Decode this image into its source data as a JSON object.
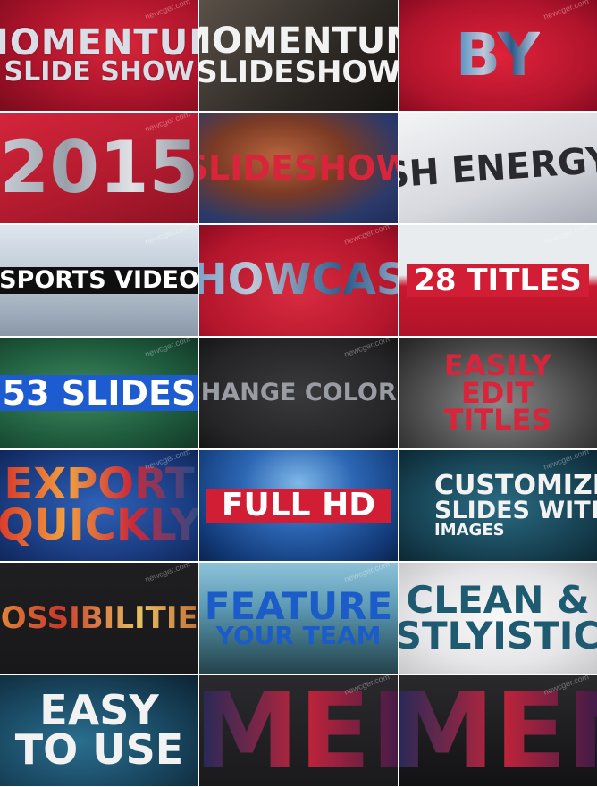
{
  "watermark": "newcger.com",
  "tiles": [
    {
      "lines": [
        "MOMENTUM",
        "SLIDE SHOW"
      ]
    },
    {
      "lines": [
        "MOMENTUM",
        "SLIDESHOW"
      ]
    },
    {
      "lines": [
        "BY"
      ]
    },
    {
      "lines": [
        "2015"
      ]
    },
    {
      "lines": [
        "SLIDESHOW"
      ]
    },
    {
      "lines": [
        "SH ENERGY"
      ]
    },
    {
      "lines": [
        "SPORTS VIDEO"
      ]
    },
    {
      "lines": [
        "SHOWCASE"
      ]
    },
    {
      "lines": [
        "28 TITLES"
      ]
    },
    {
      "lines": [
        "53 SLIDES"
      ]
    },
    {
      "lines": [
        "CHANGE COLORS"
      ]
    },
    {
      "lines": [
        "EASILY",
        "EDIT",
        "TITLES"
      ]
    },
    {
      "lines": [
        "EXPORT",
        "QUICKLY"
      ]
    },
    {
      "lines": [
        "FULL HD"
      ]
    },
    {
      "lines": [
        "CUSTOMIZE",
        "SLIDES WITH",
        "IMAGES"
      ]
    },
    {
      "lines": [
        "POSSIBILITIES"
      ]
    },
    {
      "lines": [
        "FEATURE",
        "YOUR TEAM"
      ]
    },
    {
      "lines": [
        "CLEAN &",
        "STLYISTIC"
      ]
    },
    {
      "lines": [
        "EASY",
        "TO USE"
      ]
    },
    {
      "lines": [
        "MENT"
      ]
    },
    {
      "lines": [
        "MENT"
      ]
    }
  ]
}
